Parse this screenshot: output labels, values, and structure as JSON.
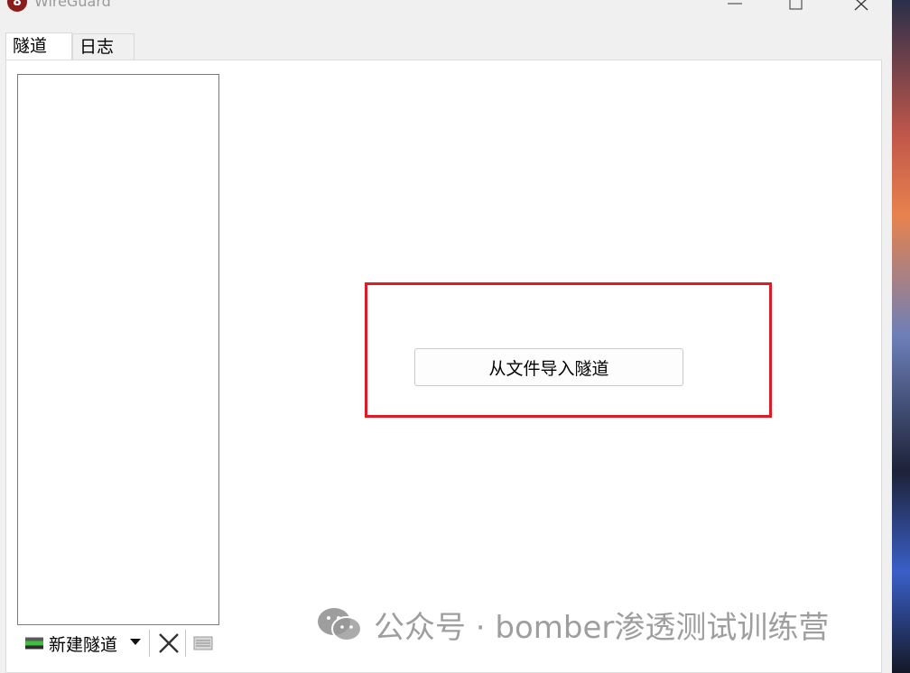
{
  "window": {
    "title": "WireGuard",
    "app_icon_glyph": "8",
    "controls": [
      "minimize-icon",
      "maximize-icon",
      "close-icon"
    ]
  },
  "tabs": [
    {
      "label": "隧道",
      "active": true
    },
    {
      "label": "日志",
      "active": false
    }
  ],
  "toolbar": {
    "new_tunnel_label": "新建隧道",
    "icons": [
      "tunnel-icon",
      "dropdown-arrow-icon",
      "delete-icon",
      "export-icon"
    ]
  },
  "main": {
    "import_button_label": "从文件导入隧道",
    "highlight_color": "#e01b24"
  },
  "watermark": {
    "text": "公众号 · bomber渗透测试训练营",
    "icon": "wechat-icon"
  }
}
